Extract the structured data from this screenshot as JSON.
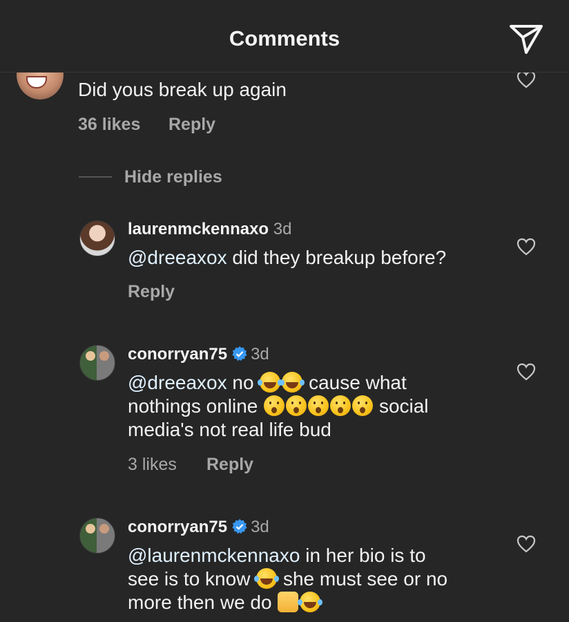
{
  "header": {
    "title": "Comments"
  },
  "parent_comment": {
    "text": "Did yous break up again",
    "likes": "36 likes",
    "reply": "Reply",
    "hide_replies": "Hide replies"
  },
  "replies": [
    {
      "username": "laurenmckennaxo",
      "time": "3d",
      "mention": "@dreeaxox",
      "line1": " did they breakup before?",
      "reply": "Reply"
    },
    {
      "username": "conorryan75",
      "time": "3d",
      "mention": "@dreeaxox",
      "line1a": " no",
      "line1b": "cause what",
      "line2a": "nothings online",
      "line2b": "social",
      "line3": "media's not real life bud",
      "likes": "3 likes",
      "reply": "Reply"
    },
    {
      "username": "conorryan75",
      "time": "3d",
      "mention": "@laurenmckennaxo",
      "line1": " in her bio is to",
      "line2a": "see is to know",
      "line2b": "she must see or no",
      "line3": "more then we do"
    }
  ],
  "icons": {
    "send": "send-icon",
    "heart": "heart-icon",
    "verified": "verified-badge-icon"
  },
  "colors": {
    "background": "#262626",
    "text": "#f5f5f5",
    "muted": "#a8a8a8",
    "verified": "#3897f0"
  }
}
